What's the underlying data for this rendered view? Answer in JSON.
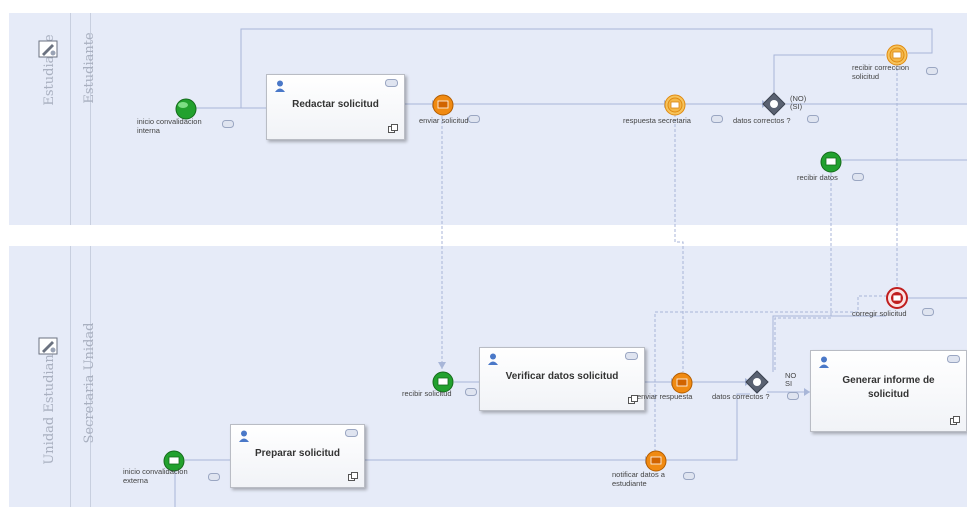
{
  "colors": {
    "pool_bg": "#e6ebf8",
    "flow": "#a8b6d8",
    "start": "#22a12e",
    "message": "#f08a12",
    "end": "#c01e1e"
  },
  "lanes": {
    "top": {
      "pool": "Estudiante",
      "lane": "Estudiante"
    },
    "bottom": {
      "pool": "Unidad Estudiante",
      "lane": "Secretaria Unidad"
    }
  },
  "tasks": {
    "redactar": "Redactar solicitud",
    "verificar": "Verificar datos solicitud",
    "preparar": "Preparar solicitud",
    "generar_line1": "Generar informe de",
    "generar_line2": "solicitud"
  },
  "events": {
    "inicio_interna": [
      "inicio convalidacion",
      "interna"
    ],
    "enviar_solicitud": "enviar solicitud",
    "respuesta_secretaria": "respuesta secretaria",
    "datos_correctos_top": "datos correctos ?",
    "recibir_correccion": [
      "recibir correccion",
      "solicitud"
    ],
    "recibir_datos": "recibir datos",
    "recibir_solicitud": "recibir solicitud",
    "enviar_respuesta": "enviar respuesta",
    "datos_correctos_bottom": "datos correctos ?",
    "corregir_solicitud": "corregir solicitud",
    "inicio_externa": [
      "inicio convalidacion",
      "externa"
    ],
    "notificar": [
      "notificar datos a",
      "estudiante"
    ]
  },
  "gateway_labels": {
    "top_no": "(NO)",
    "top_si": "(SI)",
    "bottom_no": "NO",
    "bottom_si": "SI"
  },
  "icons": [
    "role-icon",
    "user-icon",
    "comment-icon",
    "subprocess-icon",
    "envelope-icon",
    "gateway-icon"
  ]
}
